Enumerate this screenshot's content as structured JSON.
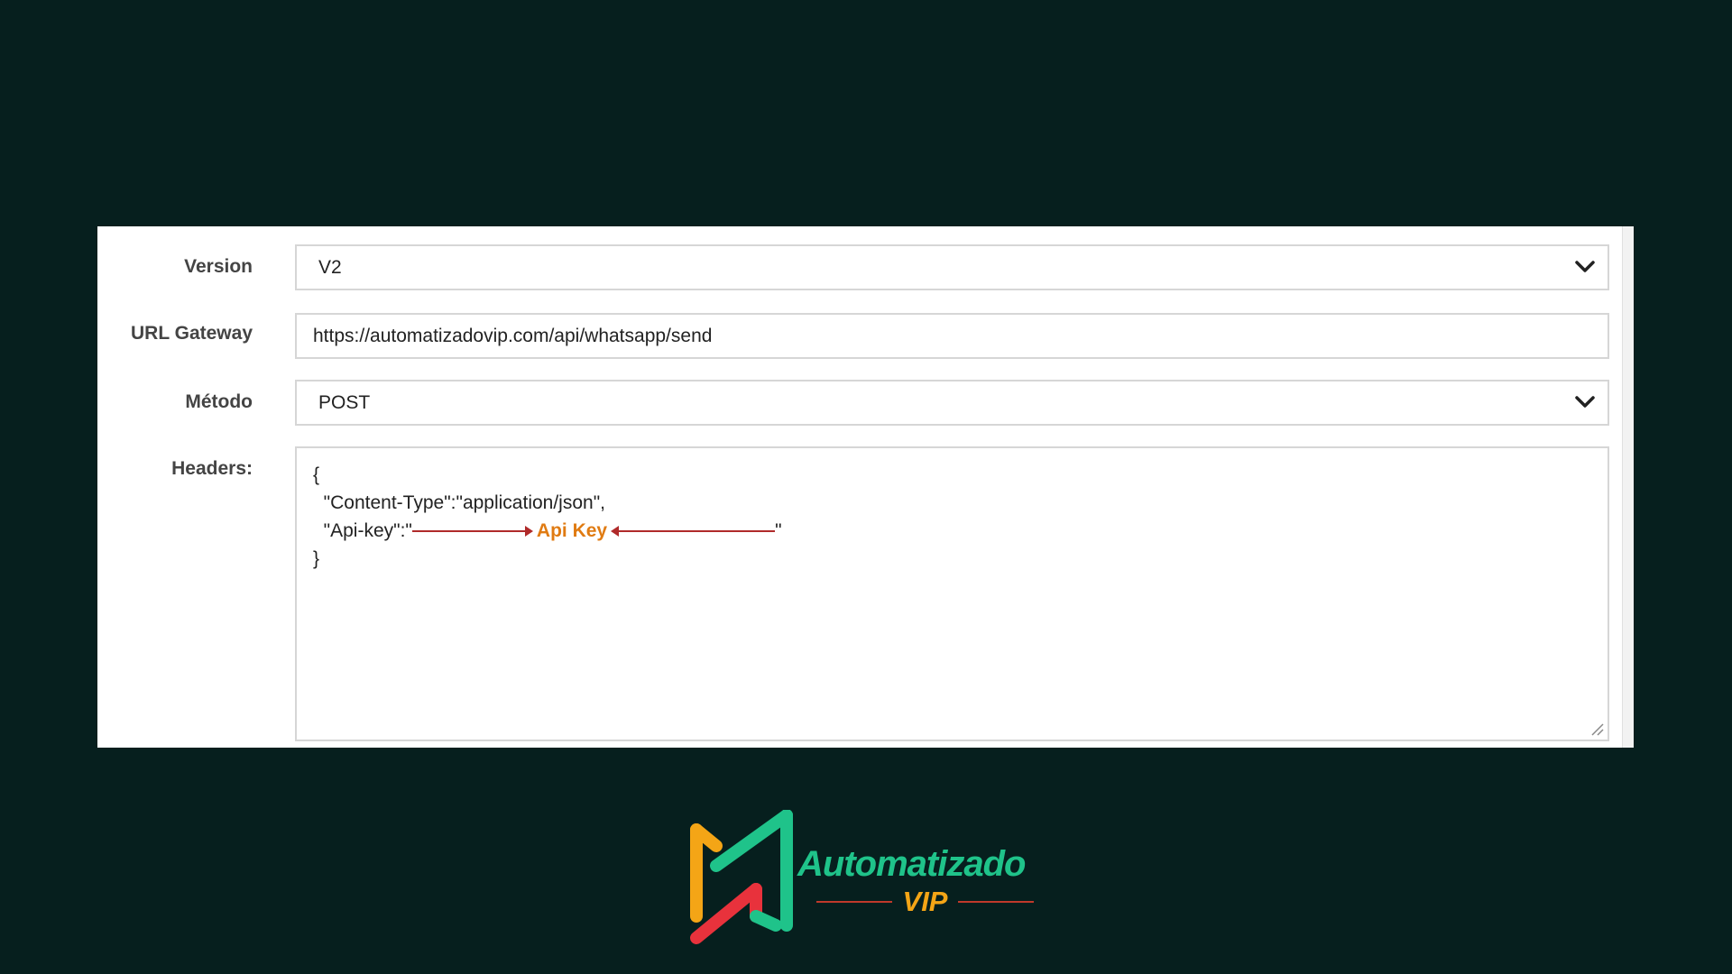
{
  "form": {
    "version": {
      "label": "Version",
      "value": "V2"
    },
    "url_gateway": {
      "label": "URL Gateway",
      "value": "https://automatizadovip.com/api/whatsapp/send"
    },
    "method": {
      "label": "Método",
      "value": "POST"
    },
    "headers": {
      "label": "Headers:",
      "line_open": "{",
      "line_content_type": "  \"Content-Type\":\"application/json\",",
      "line_api_key_start": "  \"Api-key\":\"",
      "line_api_key_end": "\"",
      "line_close": "}",
      "annotation": "Api Key"
    }
  },
  "logo": {
    "name": "Automatizado",
    "sub": "VIP"
  },
  "colors": {
    "background": "#061f1e",
    "annotation": "#e07b12",
    "arrow": "#b02a2a",
    "logo_green": "#1fc38a",
    "logo_orange": "#f4a516",
    "logo_red": "#e8323c"
  },
  "icons": {
    "select_chevron": "chevron-down-icon",
    "resize": "resize-grip-icon"
  }
}
